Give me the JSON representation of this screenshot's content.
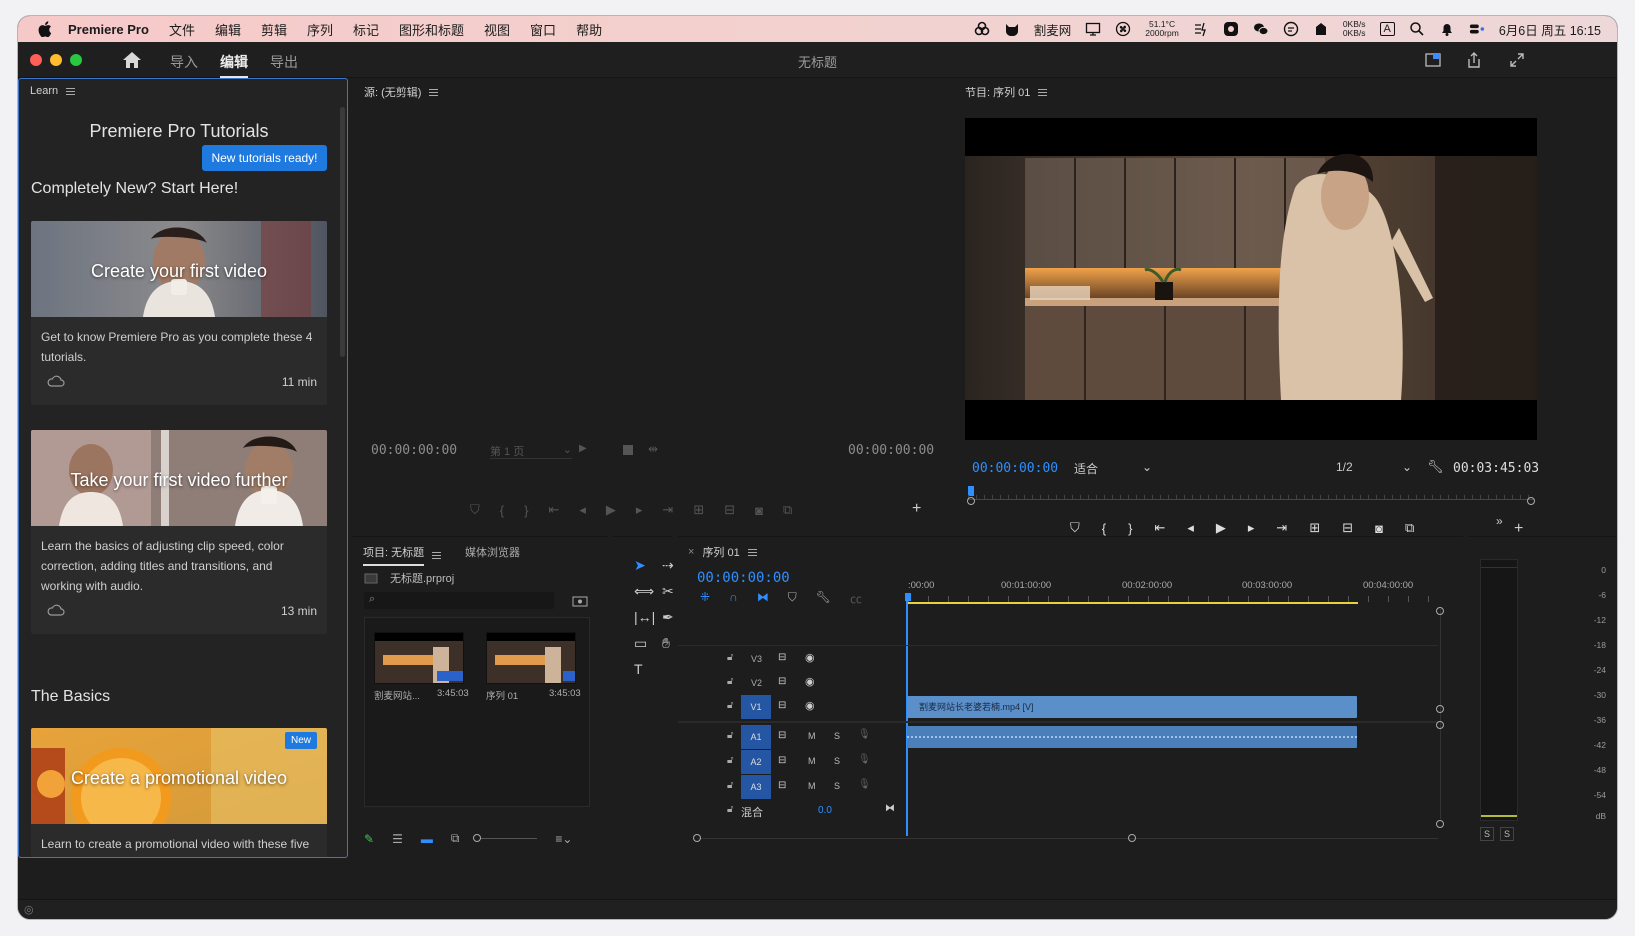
{
  "menubar": {
    "app_name": "Premiere Pro",
    "items": [
      "文件",
      "编辑",
      "剪辑",
      "序列",
      "标记",
      "图形和标题",
      "视图",
      "窗口",
      "帮助"
    ],
    "status_label": "割麦网",
    "cpu_temp": "51.1°C",
    "fan_speed": "2000rpm",
    "net_up": "0KB/s",
    "net_down": "0KB/s",
    "input_method": "A",
    "datetime": "6月6日 周五 16:15"
  },
  "header": {
    "tabs": [
      "导入",
      "编辑",
      "导出"
    ],
    "active_tab": "编辑",
    "doc_title": "无标题"
  },
  "learn": {
    "tab_label": "Learn",
    "title": "Premiere Pro Tutorials",
    "new_button": "New tutorials ready!",
    "section1": "Completely New? Start Here!",
    "section2": "The Basics",
    "cards": [
      {
        "title": "Create your first video",
        "desc": "Get to know Premiere Pro as you complete these 4 tutorials.",
        "duration": "11 min"
      },
      {
        "title": "Take your first video further",
        "desc": "Learn the basics of adjusting clip speed, color correction, adding titles and transitions, and working with audio.",
        "duration": "13 min"
      },
      {
        "title": "Create a promotional video",
        "desc": "Learn to create a promotional video with these five",
        "badge": "New"
      }
    ]
  },
  "source": {
    "tab_label": "源: (无剪辑)",
    "tc_left": "00:00:00:00",
    "page_select": "第 1 页",
    "tc_right": "00:00:00:00"
  },
  "program": {
    "tab_label": "节目: 序列 01",
    "tc": "00:00:00:00",
    "fit": "适合",
    "resolution": "1/2",
    "duration": "00:03:45:03"
  },
  "project": {
    "tab_label": "项目: 无标题",
    "tab2_label": "媒体浏览器",
    "file": "无标题.prproj",
    "items": [
      {
        "name": "割麦网站...",
        "duration": "3:45:03"
      },
      {
        "name": "序列 01",
        "duration": "3:45:03"
      }
    ]
  },
  "timeline": {
    "tab_label": "序列 01",
    "tc": "00:00:00:00",
    "ruler": [
      ":00:00",
      "00:01:00:00",
      "00:02:00:00",
      "00:03:00:00",
      "00:04:00:00"
    ],
    "video_tracks": [
      "V3",
      "V2",
      "V1"
    ],
    "audio_tracks": [
      "A1",
      "A2",
      "A3"
    ],
    "mix_label": "混合",
    "mix_value": "0.0",
    "clip_name": "割麦网站长老婆若楠.mp4 [V]",
    "m_label": "M",
    "s_label": "S"
  },
  "meters": {
    "db_labels": [
      "0",
      "-6",
      "-12",
      "-18",
      "-24",
      "-30",
      "-36",
      "-42",
      "-48",
      "-54",
      "dB"
    ],
    "solo_labels": [
      "S",
      "S"
    ]
  },
  "colors": {
    "accent": "#1f7ae0",
    "timecode": "#2f8fff",
    "clip": "#5b8fc9",
    "work_area": "#e8d23a"
  }
}
